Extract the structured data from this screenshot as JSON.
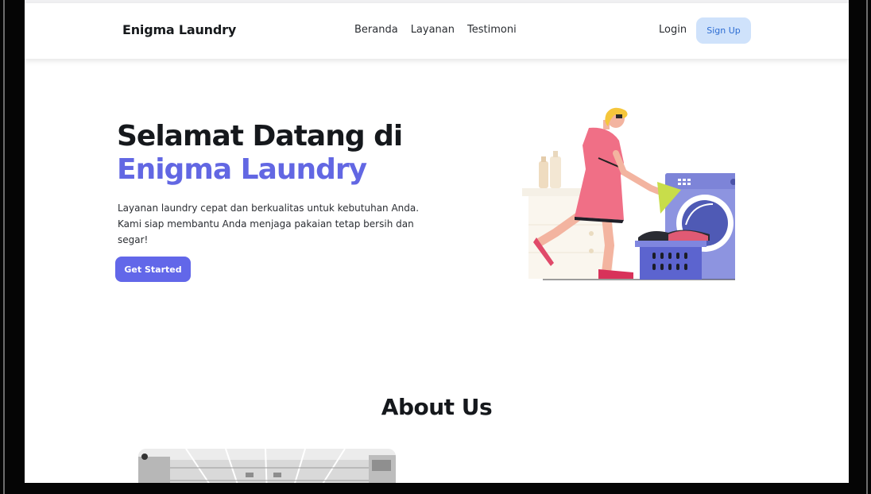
{
  "navbar": {
    "brand": "Enigma Laundry",
    "links": [
      {
        "label": "Beranda"
      },
      {
        "label": "Layanan"
      },
      {
        "label": "Testimoni"
      }
    ],
    "login_label": "Login",
    "signup_label": "Sign Up"
  },
  "hero": {
    "title_line1": "Selamat Datang di",
    "title_line2": "Enigma Laundry",
    "description": "Layanan laundry cepat dan berkualitas untuk kebutuhan Anda. Kami siap membantu Anda menjaga pakaian tetap bersih dan segar!",
    "cta_label": "Get  Started",
    "illustration_icon": "laundry-woman-washing-machine-illustration"
  },
  "about": {
    "title": "About Us",
    "image_icon": "laundromat-interior-photo"
  },
  "colors": {
    "accent": "#6267e3",
    "signup_bg": "#cfe2fb",
    "signup_text": "#2d6dd3",
    "heading": "#15181c"
  }
}
